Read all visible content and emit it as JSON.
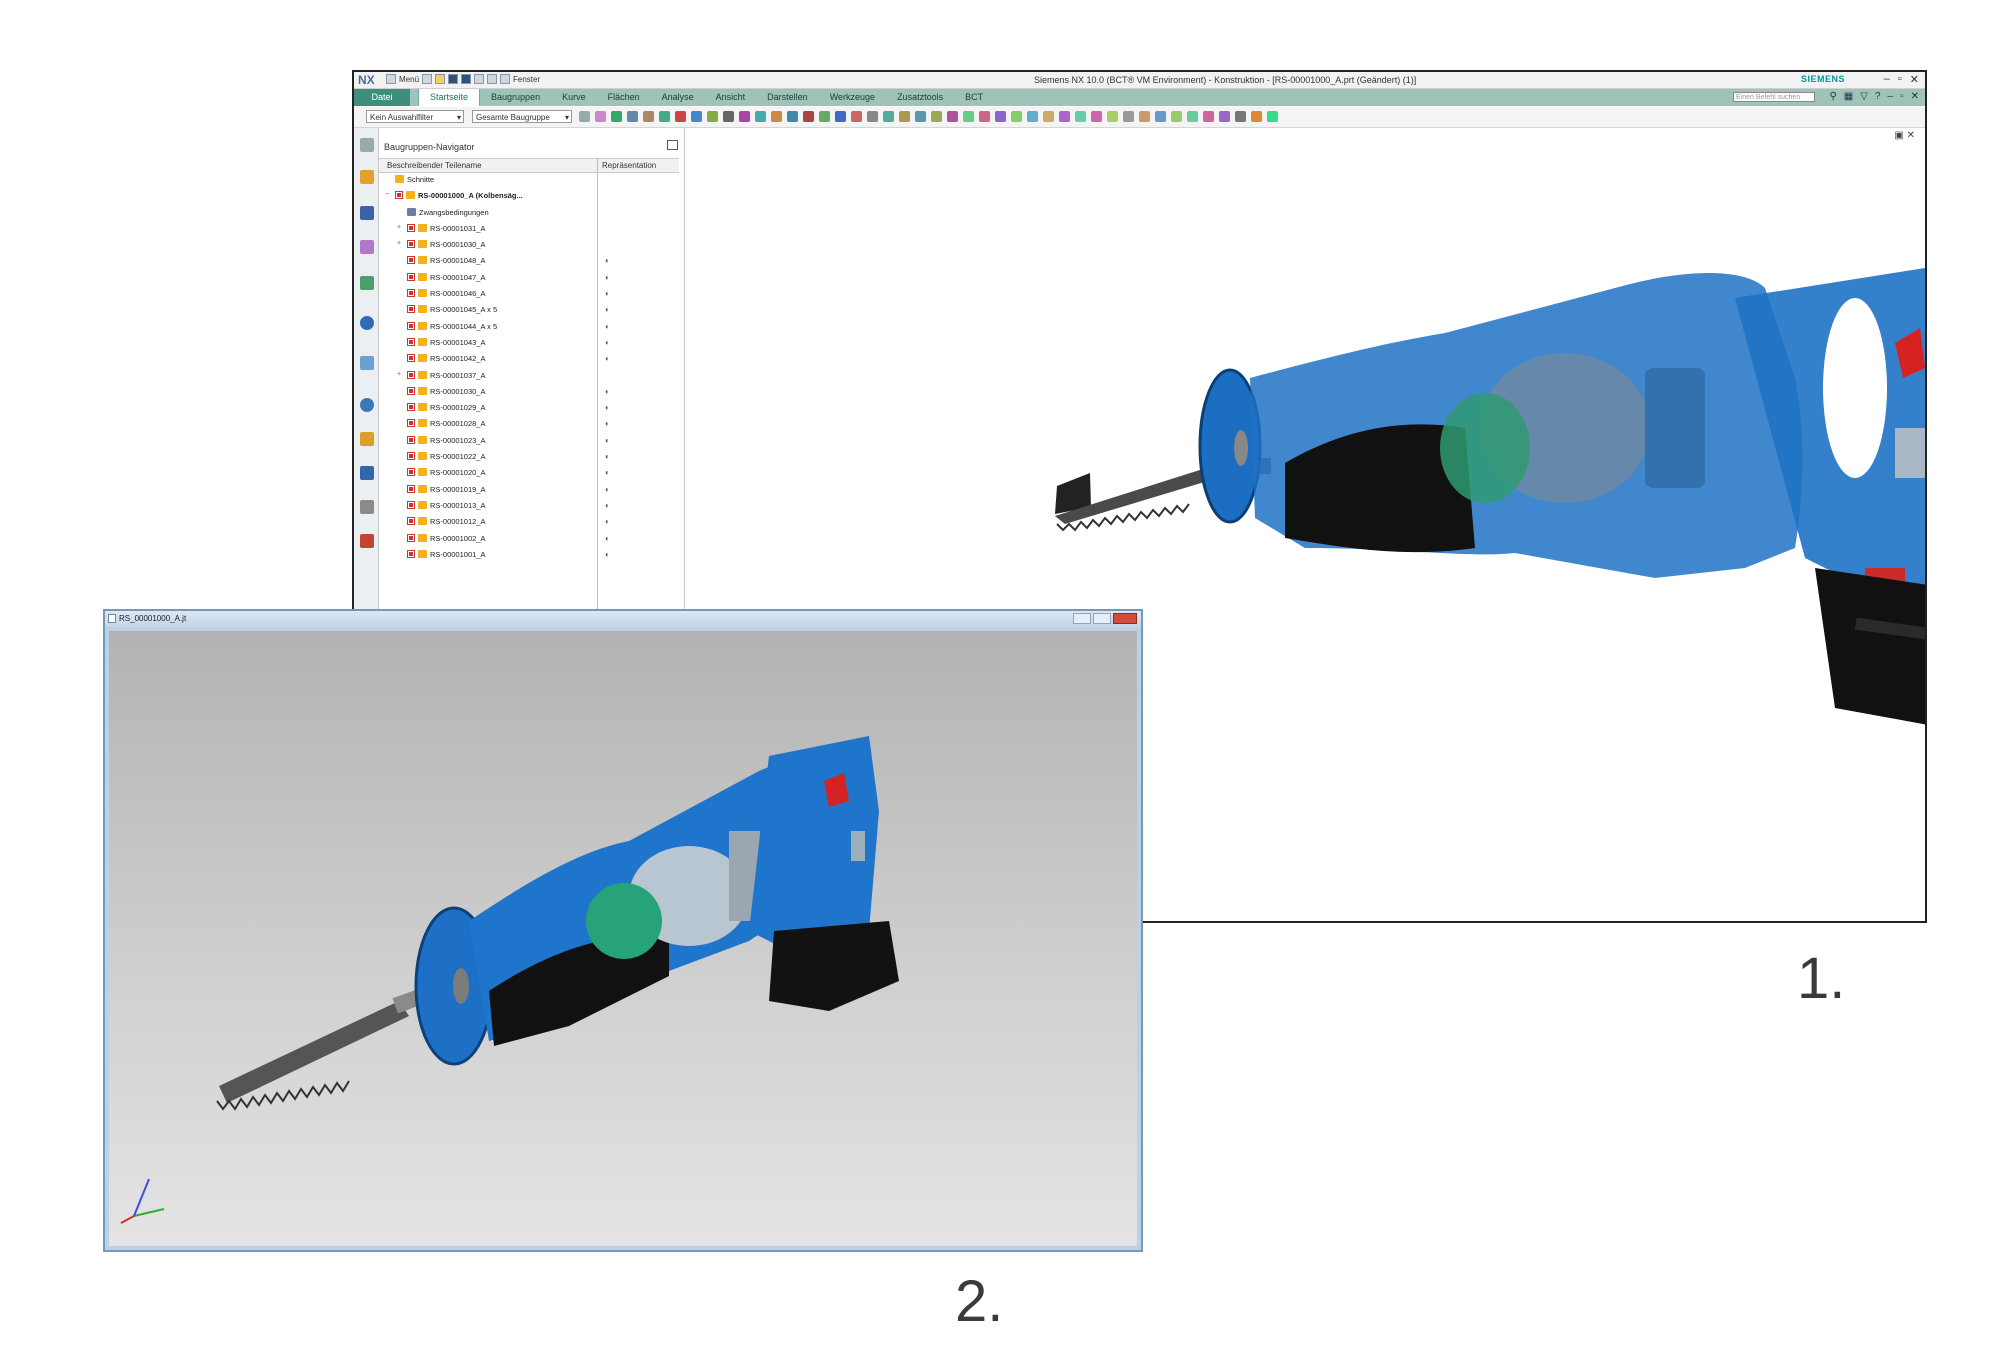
{
  "nx": {
    "logo": "NX",
    "menu_label": "Menü",
    "window_dropdown": "Fenster",
    "window_title": "Siemens NX 10.0 (BCT® VM Environment) - Konstruktion - [RS-00001000_A.prt (Geändert)   (1)]",
    "brand": "SIEMENS",
    "file_tab": "Datei",
    "ribbon_tabs": [
      "Startseite",
      "Baugruppen",
      "Kurve",
      "Flächen",
      "Analyse",
      "Ansicht",
      "Darstellen",
      "Werkzeuge",
      "Zusatztools",
      "BCT"
    ],
    "active_tab": "Startseite",
    "search_placeholder": "Einen Befehl suchen",
    "selection_filter": "Kein Auswahlfilter",
    "assembly_scope": "Gesamte Baugruppe",
    "navigator": {
      "title": "Baugruppen-Navigator",
      "col_name": "Beschreibender Teilename",
      "col_rep": "Repräsentation",
      "rows": [
        {
          "label": "Schnitte",
          "level": 0,
          "type": "folder"
        },
        {
          "label": "RS-00001000_A (Kolbensäg...",
          "level": 0,
          "type": "root"
        },
        {
          "label": "Zwangsbedingungen",
          "level": 1,
          "type": "constraints"
        },
        {
          "label": "RS-00001031_A",
          "level": 1,
          "type": "sub"
        },
        {
          "label": "RS-00001030_A",
          "level": 1,
          "type": "sub"
        },
        {
          "label": "RS-00001048_A",
          "level": 1,
          "type": "part"
        },
        {
          "label": "RS-00001047_A",
          "level": 1,
          "type": "part"
        },
        {
          "label": "RS-00001046_A",
          "level": 1,
          "type": "part"
        },
        {
          "label": "RS-00001045_A x 5",
          "level": 1,
          "type": "part"
        },
        {
          "label": "RS-00001044_A x 5",
          "level": 1,
          "type": "part"
        },
        {
          "label": "RS-00001043_A",
          "level": 1,
          "type": "part"
        },
        {
          "label": "RS-00001042_A",
          "level": 1,
          "type": "part"
        },
        {
          "label": "RS-00001037_A",
          "level": 1,
          "type": "sub"
        },
        {
          "label": "RS-00001030_A",
          "level": 1,
          "type": "part"
        },
        {
          "label": "RS-00001029_A",
          "level": 1,
          "type": "part"
        },
        {
          "label": "RS-00001028_A",
          "level": 1,
          "type": "part"
        },
        {
          "label": "RS-00001023_A",
          "level": 1,
          "type": "part"
        },
        {
          "label": "RS-00001022_A",
          "level": 1,
          "type": "part"
        },
        {
          "label": "RS-00001020_A",
          "level": 1,
          "type": "part"
        },
        {
          "label": "RS-00001019_A",
          "level": 1,
          "type": "part"
        },
        {
          "label": "RS-00001013_A",
          "level": 1,
          "type": "part"
        },
        {
          "label": "RS-00001012_A",
          "level": 1,
          "type": "part"
        },
        {
          "label": "RS-00001002_A",
          "level": 1,
          "type": "part"
        },
        {
          "label": "RS-00001001_A",
          "level": 1,
          "type": "part"
        }
      ]
    }
  },
  "viewer": {
    "title": "RS_00001000_A.jt"
  },
  "captions": {
    "one": "1.",
    "two": "2."
  },
  "colors": {
    "ribbon": "#9fc3b8",
    "file_tab": "#3e8e7c",
    "saw_body": "#1f72c4",
    "saw_black": "#111111"
  }
}
